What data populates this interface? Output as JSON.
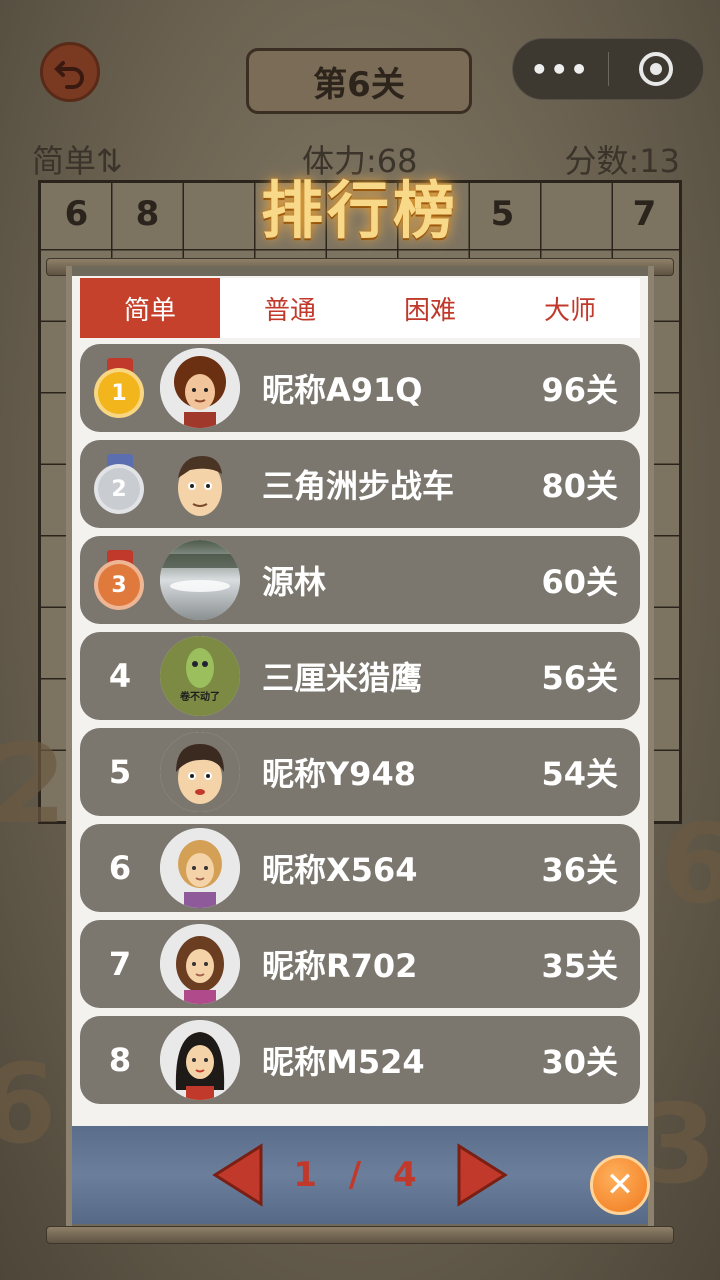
{
  "game": {
    "level_title": "第6关",
    "mode_label": "简单⇅",
    "stamina_label": "体力:68",
    "score_label": "分数:13",
    "top_row_cells": [
      "6",
      "8",
      "",
      "",
      "",
      "",
      "5",
      "",
      "7"
    ]
  },
  "capsule": {
    "more_label": "•••"
  },
  "leaderboard": {
    "title": "排行榜",
    "tabs": [
      {
        "label": "简单",
        "active": true
      },
      {
        "label": "普通",
        "active": false
      },
      {
        "label": "困难",
        "active": false
      },
      {
        "label": "大师",
        "active": false
      }
    ],
    "entries": [
      {
        "rank": "1",
        "name": "昵称A91Q",
        "levels": "96关",
        "medal": "gold",
        "avatar": "afro-boy-icon"
      },
      {
        "rank": "2",
        "name": "三角洲步战车",
        "levels": "80关",
        "medal": "silver",
        "avatar": "cartoon-man-icon"
      },
      {
        "rank": "3",
        "name": "源林",
        "levels": "60关",
        "medal": "bronze",
        "avatar": "landscape-photo-icon"
      },
      {
        "rank": "4",
        "name": "三厘米猎鹰",
        "levels": "56关",
        "medal": "",
        "avatar": "green-character-icon"
      },
      {
        "rank": "5",
        "name": "昵称Y948",
        "levels": "54关",
        "medal": "",
        "avatar": "cartoon-boy-icon"
      },
      {
        "rank": "6",
        "name": "昵称X564",
        "levels": "36关",
        "medal": "",
        "avatar": "blonde-person-icon"
      },
      {
        "rank": "7",
        "name": "昵称R702",
        "levels": "35关",
        "medal": "",
        "avatar": "brown-hair-girl-icon"
      },
      {
        "rank": "8",
        "name": "昵称M524",
        "levels": "30关",
        "medal": "",
        "avatar": "black-hair-girl-icon"
      }
    ],
    "avatar4_caption": "卷不动了",
    "pager": {
      "current": "1",
      "separator": "/",
      "total": "4"
    },
    "close_label": "✕"
  },
  "colors": {
    "active_tab": "#c6412c",
    "inactive_tab_text": "#c0392b",
    "row_bg": "#7b776e",
    "gold": "#f2b51c",
    "silver": "#c9ccd1",
    "bronze": "#e07a3c",
    "title_glow": "#f8d98a"
  }
}
